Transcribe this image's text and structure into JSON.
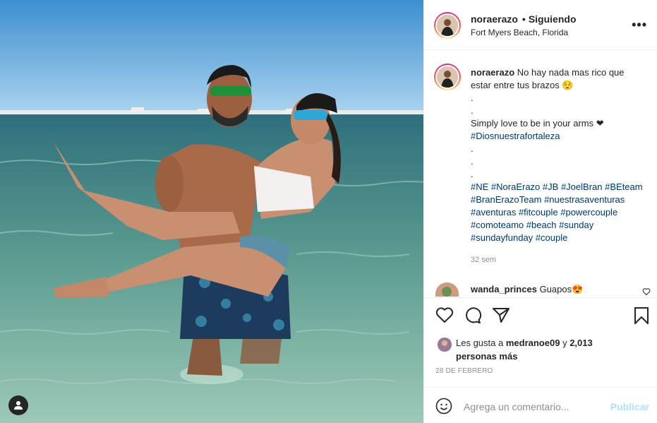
{
  "post": {
    "username": "noraerazo",
    "follow_status": "Siguiendo",
    "location": "Fort Myers Beach, Florida",
    "more_glyph": "•••"
  },
  "caption": {
    "username": "noraerazo",
    "line1": "No hay nada mas rico que estar entre tus brazos 😌",
    "dot1": ".",
    "dot2": ".",
    "line2": "Simply love to be in your arms ❤",
    "tag1": "#Diosnuestrafortaleza",
    "dot3": ".",
    "dot4": ".",
    "dot5": ".",
    "hashtags": [
      "#NE",
      "#NoraErazo",
      "#JB",
      "#JoelBran",
      "#BEteam",
      "#BranErazoTeam",
      "#nuestrasaventuras",
      "#aventuras",
      "#fitcouple",
      "#powercouple",
      "#comoteamo",
      "#beach",
      "#sunday",
      "#sundayfunday",
      "#couple"
    ],
    "time": "32 sem"
  },
  "comment": {
    "username": "wanda_princes",
    "text": "Guapos😍"
  },
  "actions": {
    "like_icon": "heart-icon",
    "comment_icon": "comment-icon",
    "share_icon": "share-icon",
    "save_icon": "bookmark-icon"
  },
  "likes": {
    "prefix": "Les gusta a",
    "liker": "medranoe09",
    "joiner": "y",
    "others": "2,013 personas más"
  },
  "date": "28 DE FEBRERO",
  "add_comment": {
    "placeholder": "Agrega un comentario...",
    "publish_label": "Publicar"
  },
  "colors": {
    "link": "#00376b",
    "muted": "#8e8e8e",
    "publish_disabled": "#b2dffc"
  }
}
